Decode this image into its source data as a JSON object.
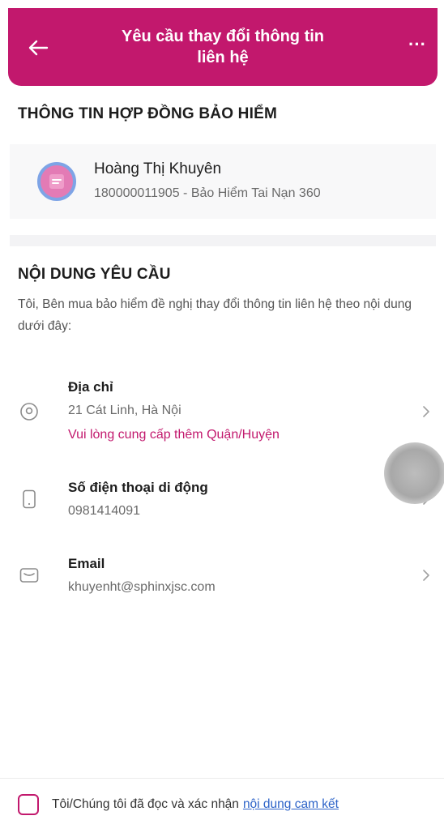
{
  "header": {
    "title_line1": "Yêu cầu thay đổi thông tin",
    "title_line2": "liên hệ",
    "more_label": "···"
  },
  "contract": {
    "section_title": "THÔNG TIN HỢP ĐỒNG BẢO HIỂM",
    "holder_name": "Hoàng Thị Khuyên",
    "contract_info": "180000011905 - Bảo Hiểm Tai Nạn 360"
  },
  "request": {
    "section_title": "NỘI DUNG YÊU CẦU",
    "intro": "Tôi, Bên mua bảo hiểm đề nghị thay đổi thông tin liên hệ theo nội dung dưới đây:",
    "address": {
      "label": "Địa chỉ",
      "value": "21 Cát Linh, Hà Nội",
      "hint": "Vui lòng cung cấp thêm Quận/Huyện"
    },
    "phone": {
      "label": "Số điện thoại di động",
      "value": "0981414091"
    },
    "email": {
      "label": "Email",
      "value": "khuyenht@sphinxjsc.com"
    }
  },
  "consent": {
    "text": "Tôi/Chúng tôi đã đọc và xác nhận",
    "link": "nội dung cam kết"
  },
  "colors": {
    "brand": "#c2186d",
    "link": "#2d63c8"
  }
}
